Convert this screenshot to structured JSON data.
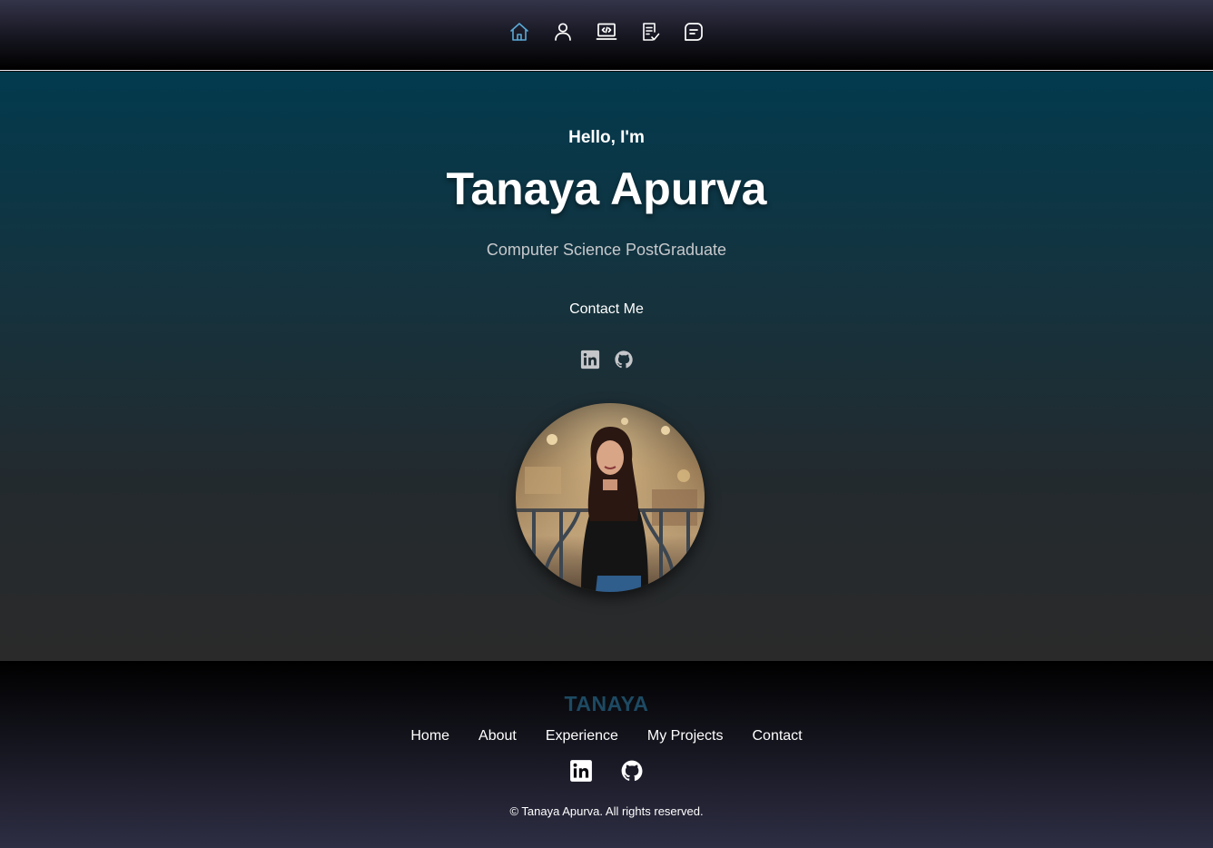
{
  "nav": {
    "items": [
      {
        "icon": "home-icon",
        "active": true
      },
      {
        "icon": "user-icon",
        "active": false
      },
      {
        "icon": "laptop-code-icon",
        "active": false
      },
      {
        "icon": "checklist-icon",
        "active": false
      },
      {
        "icon": "message-icon",
        "active": false
      }
    ]
  },
  "hero": {
    "greeting": "Hello, I'm",
    "name": "Tanaya Apurva",
    "role": "Computer Science PostGraduate",
    "contact_label": "Contact Me",
    "social": [
      "linkedin-icon",
      "github-icon"
    ]
  },
  "footer": {
    "brand": "TANAYA",
    "links": [
      "Home",
      "About",
      "Experience",
      "My Projects",
      "Contact"
    ],
    "social": [
      "linkedin-icon",
      "github-icon"
    ],
    "copyright": "© Tanaya Apurva. All rights reserved."
  },
  "colors": {
    "nav_active": "#5aa9d6",
    "nav_icon": "#ffffff",
    "brand": "#1d4a63",
    "hero_top": "#023a4e",
    "hero_bottom": "#2a2a2a"
  }
}
